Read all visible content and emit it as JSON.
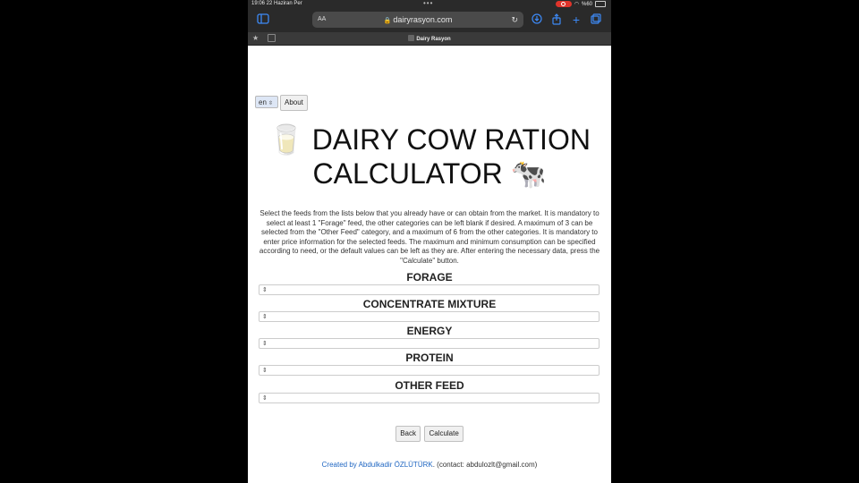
{
  "status_bar": {
    "time_date": "19:06  22 Haziran Per",
    "dots": "•••",
    "battery": "%60"
  },
  "browser": {
    "aa_label": "AA",
    "url": "dairyrasyon.com",
    "tab_title": "Dairy Rasyon"
  },
  "header": {
    "lang_value": "en",
    "about_label": "About"
  },
  "title": {
    "line1": "🥛 DAIRY COW RATION",
    "line2": "CALCULATOR 🐄"
  },
  "description": "Select the feeds from the lists below that you already have or can obtain from the market. It is mandatory to select at least 1 \"Forage\" feed, the other categories can be left blank if desired. A maximum of 3 can be selected from the \"Other Feed\" category, and a maximum of 6 from the other categories. It is mandatory to enter price information for the selected feeds. The maximum and minimum consumption can be specified according to need, or the default values can be left as they are. After entering the necessary data, press the \"Calculate\" button.",
  "sections": {
    "forage": "FORAGE",
    "concentrate": "CONCENTRATE MIXTURE",
    "energy": "ENERGY",
    "protein": "PROTEIN",
    "other": "OTHER FEED"
  },
  "buttons": {
    "back": "Back",
    "calculate": "Calculate"
  },
  "footer": {
    "created_by": "Created by Abdulkadir ÖZLÜTÜRK",
    "contact": ". (contact: abdulozlt@gmail.com)"
  },
  "colors": {
    "accent": "#3d8af7",
    "link": "#1f66c2",
    "recording": "#e0342b"
  }
}
